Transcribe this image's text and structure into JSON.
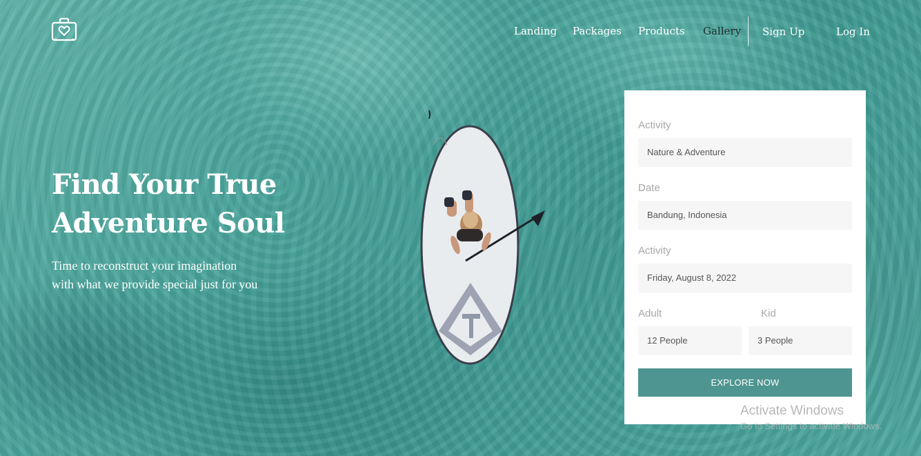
{
  "nav": {
    "items": [
      {
        "label": "Landing"
      },
      {
        "label": "Packages"
      },
      {
        "label": "Products"
      },
      {
        "label": "Gallery",
        "active": true
      },
      {
        "label": "Sign Up"
      },
      {
        "label": "Log In"
      }
    ]
  },
  "hero": {
    "title_line1": "Find Your True",
    "title_line2": "Adventure Soul",
    "subtitle_line1": "Time to reconstruct your imagination",
    "subtitle_line2": "with what we provide special just for you"
  },
  "form": {
    "activity": {
      "label": "Activity",
      "value": "Nature & Adventure"
    },
    "date": {
      "label": "Date",
      "value": "Bandung, Indonesia"
    },
    "activity2": {
      "label": "Activity",
      "value": "Friday, August 8, 2022"
    },
    "adult": {
      "label": "Adult",
      "value": "12 People"
    },
    "kid": {
      "label": "Kid",
      "value": "3 People"
    },
    "submit_label": "EXPLORE NOW"
  },
  "watermark": {
    "title": "Activate Windows",
    "subtitle": "Go to Settings to activate Windows."
  },
  "icons": {
    "logo": "suitcase-heart-icon"
  },
  "colors": {
    "accent": "#4e9591",
    "nav_active": "#1f2b2a",
    "field_bg": "#f6f6f6",
    "label": "#a7a7a7"
  }
}
